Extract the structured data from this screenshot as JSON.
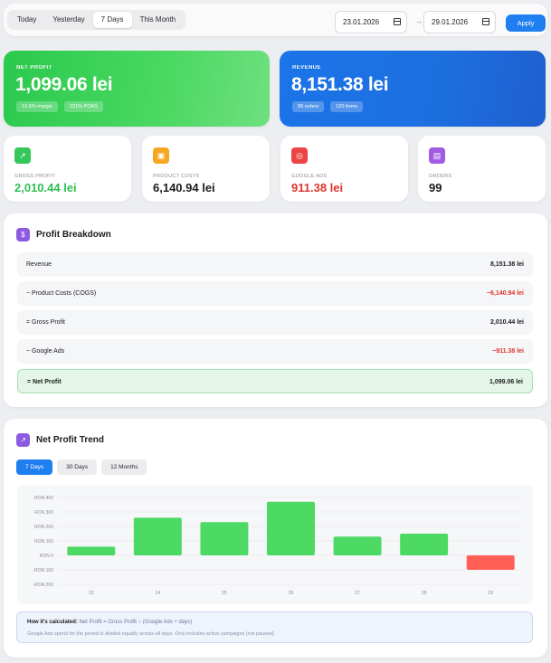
{
  "toolbar": {
    "ranges": [
      "Today",
      "Yesterday",
      "7 Days",
      "This Month"
    ],
    "active_range": "7 Days",
    "date_from": "23.01.2026",
    "date_to": "29.01.2026",
    "arrow": "→",
    "apply_label": "Apply"
  },
  "net_profit": {
    "label": "NET PROFIT",
    "value": "1,099.06 lei",
    "pills": [
      "13.5% margin",
      "221% POAS"
    ]
  },
  "revenue": {
    "label": "REVENUE",
    "value": "8,151.38 lei",
    "pills": [
      "99 orders",
      "120 items"
    ]
  },
  "stats": [
    {
      "label": "GROSS PROFIT",
      "value": "2,010.44 lei",
      "icon": "chart-icon",
      "icon_color": "#34c759",
      "value_color": "#2fbf52"
    },
    {
      "label": "PRODUCT COSTS",
      "value": "6,140.94 lei",
      "icon": "box-icon",
      "icon_color": "#f5a623",
      "value_color": "#1c1c1e"
    },
    {
      "label": "GOOGLE ADS",
      "value": "911.38 lei",
      "icon": "target-icon",
      "icon_color": "#ec4444",
      "value_color": "#e0342b"
    },
    {
      "label": "ORDERS",
      "value": "99",
      "icon": "cart-icon",
      "icon_color": "#a25be3",
      "value_color": "#1c1c1e"
    }
  ],
  "breakdown": {
    "title": "Profit Breakdown",
    "rows": [
      {
        "label": "Revenue",
        "value": "8,151.38 lei",
        "negative": false
      },
      {
        "label": "− Product Costs (COGS)",
        "value": "−6,140.94 lei",
        "negative": true
      },
      {
        "label": "= Gross Profit",
        "value": "2,010.44 lei",
        "negative": false
      },
      {
        "label": "− Google Ads",
        "value": "−911.38 lei",
        "negative": true
      },
      {
        "label": "= Net Profit",
        "value": "1,099.06 lei",
        "negative": false
      }
    ]
  },
  "trend": {
    "title": "Net Profit Trend",
    "tabs": [
      "7 Days",
      "30 Days",
      "12 Months"
    ],
    "active_tab": "7 Days",
    "info_title": "How it's calculated:",
    "info_formula": "Net Profit = Gross Profit − (Google Ads ÷ days)",
    "info_note": "Google Ads spend for the period is divided equally across all days. Only includes active campaigns (not paused)."
  },
  "chart_data": {
    "type": "bar",
    "categories": [
      "23",
      "24",
      "25",
      "26",
      "27",
      "28",
      "29"
    ],
    "values": [
      60,
      260,
      230,
      370,
      130,
      150,
      -100
    ],
    "yticks": [
      "RON 400",
      "RON 300",
      "RON 200",
      "RON 100",
      "RON 0",
      "-RON 100",
      "-RON 200"
    ],
    "ylim": [
      -200,
      400
    ],
    "positive_color": "#4cd964",
    "negative_color": "#ff5f57",
    "grid": true
  },
  "colors": {
    "accent": "#1f7ff0",
    "green": "#34c759",
    "red": "#e0342b"
  }
}
